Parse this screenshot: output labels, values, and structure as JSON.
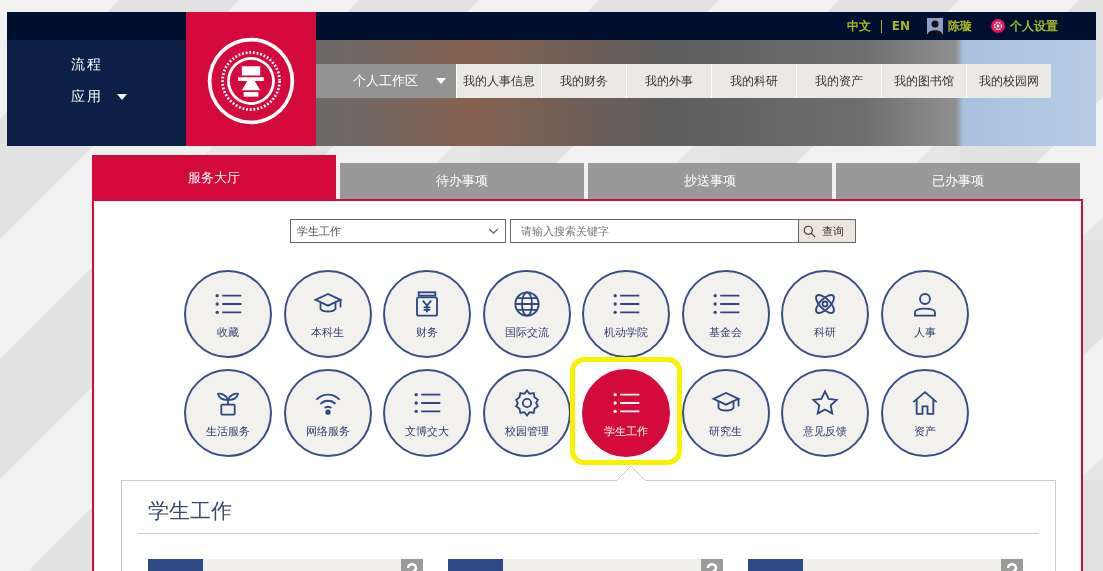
{
  "top_bar": {
    "languages": [
      {
        "label": "中文"
      },
      {
        "label": "EN"
      }
    ],
    "user": {
      "name": "陈璇"
    },
    "settings": {
      "label": "个人设置"
    }
  },
  "sidebar": {
    "items": [
      {
        "label": "流程",
        "kind": "link"
      },
      {
        "label": "应用",
        "kind": "dropdown"
      }
    ]
  },
  "nav": {
    "workspace": {
      "label": "个人工作区"
    },
    "links": [
      "我的人事信息",
      "我的财务",
      "我的外事",
      "我的科研",
      "我的资产",
      "我的图书馆",
      "我的校园网"
    ]
  },
  "tabs": [
    {
      "label": "服务大厅",
      "selected": true
    },
    {
      "label": "待办事项",
      "selected": false
    },
    {
      "label": "抄送事项",
      "selected": false
    },
    {
      "label": "已办事项",
      "selected": false
    }
  ],
  "search": {
    "category": "学生工作",
    "placeholder": "请输入搜索关键字",
    "button": "查询"
  },
  "services": [
    {
      "label": "收藏",
      "kind": "list",
      "selected": false,
      "highlighted": false
    },
    {
      "label": "本科生",
      "kind": "cap",
      "selected": false,
      "highlighted": false
    },
    {
      "label": "财务",
      "kind": "money",
      "selected": false,
      "highlighted": false
    },
    {
      "label": "国际交流",
      "kind": "globe",
      "selected": false,
      "highlighted": false
    },
    {
      "label": "机动学院",
      "kind": "list",
      "selected": false,
      "highlighted": false
    },
    {
      "label": "基金会",
      "kind": "list",
      "selected": false,
      "highlighted": false
    },
    {
      "label": "科研",
      "kind": "atom",
      "selected": false,
      "highlighted": false
    },
    {
      "label": "人事",
      "kind": "person",
      "selected": false,
      "highlighted": false
    },
    {
      "label": "生活服务",
      "kind": "sprout",
      "selected": false,
      "highlighted": false
    },
    {
      "label": "网络服务",
      "kind": "wifi",
      "selected": false,
      "highlighted": false
    },
    {
      "label": "文博交大",
      "kind": "list",
      "selected": false,
      "highlighted": false
    },
    {
      "label": "校园管理",
      "kind": "gear",
      "selected": false,
      "highlighted": false
    },
    {
      "label": "学生工作",
      "kind": "list",
      "selected": true,
      "highlighted": true
    },
    {
      "label": "研究生",
      "kind": "cap",
      "selected": false,
      "highlighted": false
    },
    {
      "label": "意见反馈",
      "kind": "star",
      "selected": false,
      "highlighted": false
    },
    {
      "label": "资产",
      "kind": "house",
      "selected": false,
      "highlighted": false
    }
  ],
  "panel": {
    "title": "学生工作",
    "cards": [
      {
        "kind": "help"
      },
      {
        "kind": "help"
      },
      {
        "kind": "help"
      }
    ]
  }
}
